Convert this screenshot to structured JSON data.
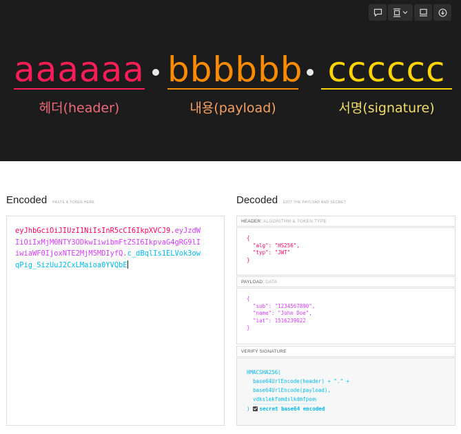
{
  "banner": {
    "segments": [
      {
        "text": "aaaaaa",
        "caption": "헤더(header)",
        "color": "#ff1d58",
        "caption_color": "#f06a7a"
      },
      {
        "text": "bbbbbb",
        "caption": "내용(payload)",
        "color": "#ff8c00",
        "caption_color": "#f5a060"
      },
      {
        "text": "cccccc",
        "caption": "서명(signature)",
        "color": "#ffd400",
        "caption_color": "#f0dc6a"
      }
    ],
    "toolbar_icons": [
      "comment-icon",
      "frame-icon",
      "chevron-down-icon",
      "present-icon",
      "download-icon"
    ]
  },
  "encoded": {
    "title": "Encoded",
    "subtitle": "PASTE A TOKEN HERE",
    "header_part": "eyJhbGciOiJIUzI1NiIsInR5cCI6IkpXVCJ9",
    "payload_part": "eyJzdWIiOiIxMjM0NTY3ODkwIiwibmFtZSI6IkpvaG4gRG9lIiwiaWF0IjoxNTE2MjM5MDIyfQ",
    "signature_part": "c_dBqlIs1ELVok3owqPig_SizUuJ2CxLMaioa0YVQbE",
    "dot": "."
  },
  "decoded": {
    "title": "Decoded",
    "subtitle": "EDIT THE PAYLOAD AND SECRET",
    "header": {
      "label": "HEADER:",
      "label_sub": "ALGORITHM & TOKEN TYPE",
      "open": "{",
      "alg": "\"alg\": \"HS256\",",
      "typ": "\"typ\": \"JWT\"",
      "close": "}"
    },
    "payload": {
      "label": "PAYLOAD:",
      "label_sub": "DATA",
      "open": "{",
      "sub": "\"sub\": \"1234567890\",",
      "name": "\"name\": \"John Doe\",",
      "iat": "\"iat\": 1516239022",
      "close": "}"
    },
    "signature": {
      "label": "VERIFY SIGNATURE",
      "fn": "HMACSHA256(",
      "line1": "base64UrlEncode(header) + \".\" +",
      "line2": "base64UrlEncode(payload),",
      "secret_value": "vdkslekfomdslkdmfpoew",
      "close": ")",
      "checkbox_label": "secret base64 encoded"
    }
  }
}
